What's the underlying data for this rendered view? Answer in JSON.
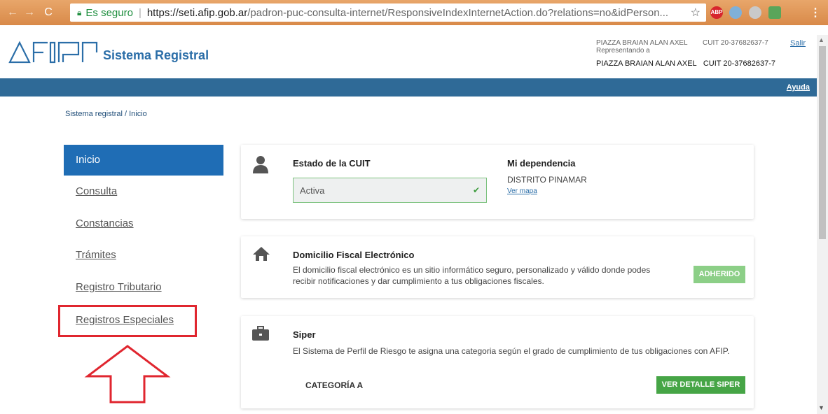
{
  "browser": {
    "secure_label": "Es seguro",
    "url_host": "https://seti.afip.gob.ar",
    "url_path": "/padron-puc-consulta-internet/ResponsiveIndexInternetAction.do?relations=no&idPerson...",
    "ext_abp": "ABP"
  },
  "header": {
    "title": "Sistema Registral",
    "user_name": "PIAZZA BRAIAN ALAN AXEL",
    "user_cuit": "CUIT 20-37682637-7",
    "representing_label": "Representando a",
    "rep_name": "PIAZZA BRAIAN ALAN AXEL",
    "rep_cuit": "CUIT 20-37682637-7",
    "logout": "Salir"
  },
  "navbar": {
    "help": "Ayuda"
  },
  "breadcrumb": "Sistema registral  /  Inicio",
  "sidebar": {
    "items": [
      {
        "label": "Inicio"
      },
      {
        "label": "Consulta"
      },
      {
        "label": "Constancias"
      },
      {
        "label": "Trámites"
      },
      {
        "label": "Registro Tributario"
      },
      {
        "label": "Registros Especiales"
      }
    ]
  },
  "cards": {
    "estado": {
      "title": "Estado de la CUIT",
      "value": "Activa",
      "dep_title": "Mi dependencia",
      "dep_name": "DISTRITO PINAMAR",
      "map_link": "Ver mapa"
    },
    "domicilio": {
      "title": "Domicilio Fiscal Electrónico",
      "text": "El domicilio fiscal electrónico es un sitio informático seguro, personalizado y válido donde podes recibir notificaciones y dar cumplimiento a tus obligaciones fiscales.",
      "status": "ADHERIDO"
    },
    "siper": {
      "title": "Siper",
      "text": "El Sistema de Perfil de Riesgo te asigna una categoria según el grado de cumplimiento de tus obligaciones con AFIP.",
      "category": "CATEGORÍA A",
      "button": "VER DETALLE SIPER"
    }
  },
  "colors": {
    "brand_blue": "#2f6a97",
    "active_blue": "#1f6db5",
    "success_green": "#46a546",
    "highlight_red": "#e0262f"
  }
}
